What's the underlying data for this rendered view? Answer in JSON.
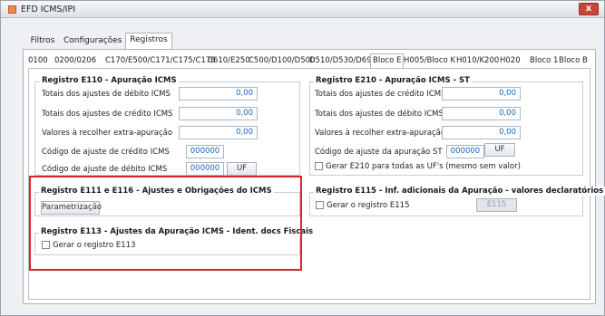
{
  "window": {
    "title": "EFD ICMS/IPI",
    "close_label": "x"
  },
  "tabs": [
    {
      "label": "Filtros"
    },
    {
      "label": "Configurações"
    },
    {
      "label": "Registros"
    }
  ],
  "subtabs": [
    {
      "label": "0100"
    },
    {
      "label": "0200/0206"
    },
    {
      "label": "C170/E500/C171/C175/C176"
    },
    {
      "label": "C610/E250"
    },
    {
      "label": "C500/D100/D500"
    },
    {
      "label": "D510/D530/D695"
    },
    {
      "label": "Bloco E"
    },
    {
      "label": "H005/Bloco K"
    },
    {
      "label": "H010/K200"
    },
    {
      "label": "H020"
    },
    {
      "label": "Bloco 1"
    },
    {
      "label": "Bloco B"
    }
  ],
  "e110": {
    "title": "Registro E110 - Apuração ICMS",
    "debitos_label": "Totais dos ajustes de débito ICMS",
    "debitos_value": "0,00",
    "creditos_label": "Totais dos ajustes de crédito ICMS",
    "creditos_value": "0,00",
    "valores_label": "Valores à recolher extra-apuração",
    "valores_value": "0,00",
    "cod_credito_label": "Código de ajuste de crédito ICMS",
    "cod_credito_value": "000000",
    "cod_debito_label": "Código de ajuste de débito ICMS",
    "cod_debito_value": "000000",
    "uf_label": "UF"
  },
  "e210": {
    "title": "Registro E210 - Apuração ICMS - ST",
    "creditos_label": "Totais dos ajustes de crédito ICMS",
    "creditos_value": "0,00",
    "debitos_label": "Totais dos ajustes de débito ICMS",
    "debitos_value": "0,00",
    "valores_label": "Valores à recolher extra-apuração",
    "valores_value": "0,00",
    "cod_label": "Código de ajuste da apuração ST",
    "cod_value": "000000",
    "uf_label": "UF",
    "gerar_label": "Gerar E210 para todas as UF's (mesmo sem valor)"
  },
  "e111": {
    "title": "Registro E111 e E116 - Ajustes e Obrigações do ICMS",
    "button_label": "Parametrização"
  },
  "e115": {
    "title": "Registro E115 - Inf. adicionais da Apuração - valores declaratórios",
    "gerar_label": "Gerar o registro E115",
    "button_label": "E115"
  },
  "e113": {
    "title": "Registro E113 - Ajustes da Apuração ICMS - Ident. docs Fiscais",
    "gerar_label": "Gerar o registro E113"
  },
  "colors": {
    "highlight": "#d9262b",
    "value_text": "#1565c0"
  }
}
